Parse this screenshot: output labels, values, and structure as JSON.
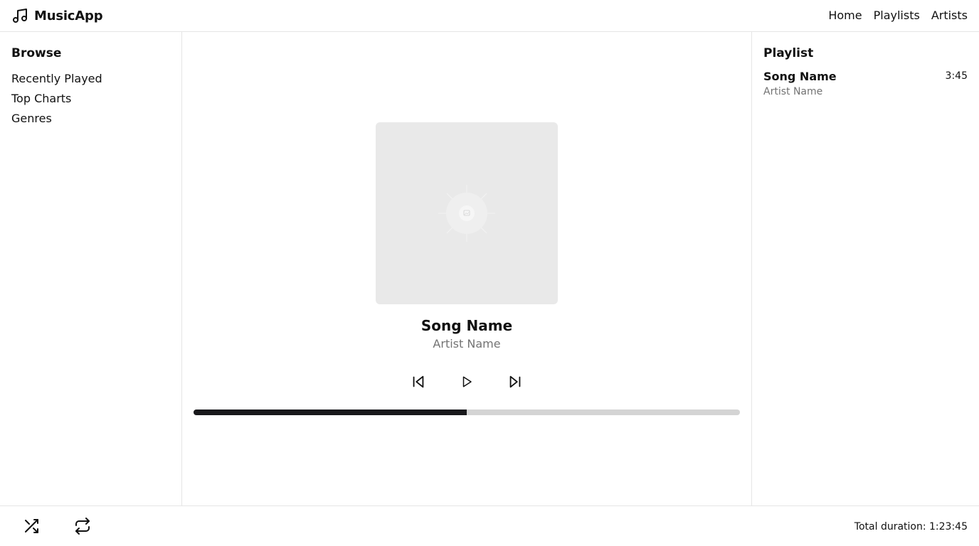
{
  "app": {
    "name": "MusicApp",
    "logo_icon": "music-note-icon"
  },
  "nav": {
    "items": [
      "Home",
      "Playlists",
      "Artists"
    ]
  },
  "sidebar": {
    "title": "Browse",
    "items": [
      "Recently Played",
      "Top Charts",
      "Genres"
    ]
  },
  "player": {
    "song_title": "Song Name",
    "artist": "Artist Name",
    "album_art_icon": "image-placeholder-icon",
    "controls": [
      "skip-back-icon",
      "play-icon",
      "skip-forward-icon"
    ],
    "progress": 0.5
  },
  "playlist": {
    "title": "Playlist",
    "tracks": [
      {
        "title": "Song Name",
        "artist": "Artist Name",
        "duration": "3:45"
      }
    ]
  },
  "footer": {
    "shuffle_icon": "shuffle-icon",
    "repeat_icon": "repeat-icon",
    "total_duration": "Total duration: 1:23:45"
  },
  "colors": {
    "progress_fill": "#18181b",
    "progress_track": "#d4d4d4",
    "muted_text": "#737373",
    "art_bg": "#e9e9e9",
    "border": "#e5e5e5"
  }
}
